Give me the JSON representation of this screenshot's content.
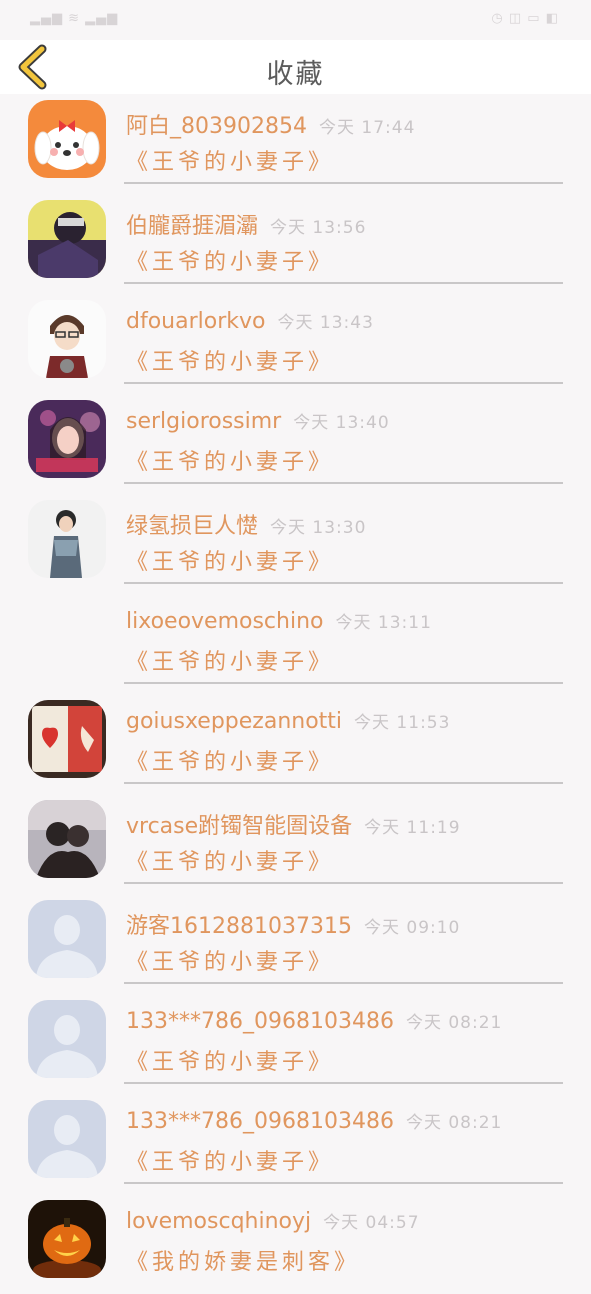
{
  "status_bar": {
    "left": "▂▄▆ ≋ ▂▄▆",
    "right": "◷ ◫ ▭ ◧"
  },
  "header": {
    "title": "收藏"
  },
  "items": [
    {
      "username": "阿白_803902854",
      "time": "今天 17:44",
      "book": "《王爷的小妻子》",
      "avatar": "cartoon-dog"
    },
    {
      "username": "伯朧爵捱湄灞",
      "time": "今天 13:56",
      "book": "《王爷的小妻子》",
      "avatar": "photo"
    },
    {
      "username": "dfouarlorkvo",
      "time": "今天 13:43",
      "book": "《王爷的小妻子》",
      "avatar": "illustration"
    },
    {
      "username": "serlgiorossimr",
      "time": "今天 13:40",
      "book": "《王爷的小妻子》",
      "avatar": "photo"
    },
    {
      "username": "绿氢损巨人憷",
      "time": "今天 13:30",
      "book": "《王爷的小妻子》",
      "avatar": "photo"
    },
    {
      "username": "lixoeovemoschino",
      "time": "今天 13:11",
      "book": "《王爷的小妻子》",
      "avatar": "none"
    },
    {
      "username": "goiusxeppezannotti",
      "time": "今天 11:53",
      "book": "《王爷的小妻子》",
      "avatar": "photo"
    },
    {
      "username": "vrcase跗镯智能圄设备",
      "time": "今天 11:19",
      "book": "《王爷的小妻子》",
      "avatar": "photo"
    },
    {
      "username": "游客1612881037315",
      "time": "今天 09:10",
      "book": "《王爷的小妻子》",
      "avatar": "default"
    },
    {
      "username": "133***786_0968103486",
      "time": "今天 08:21",
      "book": "《王爷的小妻子》",
      "avatar": "default"
    },
    {
      "username": "133***786_0968103486",
      "time": "今天 08:21",
      "book": "《王爷的小妻子》",
      "avatar": "default"
    },
    {
      "username": "lovemoscqhinoyj",
      "time": "今天 04:57",
      "book": "《我的娇妻是刺客》",
      "avatar": "pumpkin"
    }
  ],
  "colors": {
    "accent": "#e0965e",
    "back_icon": "#f2c53d",
    "muted": "#c9c5c7",
    "background": "#f8f6f7"
  }
}
